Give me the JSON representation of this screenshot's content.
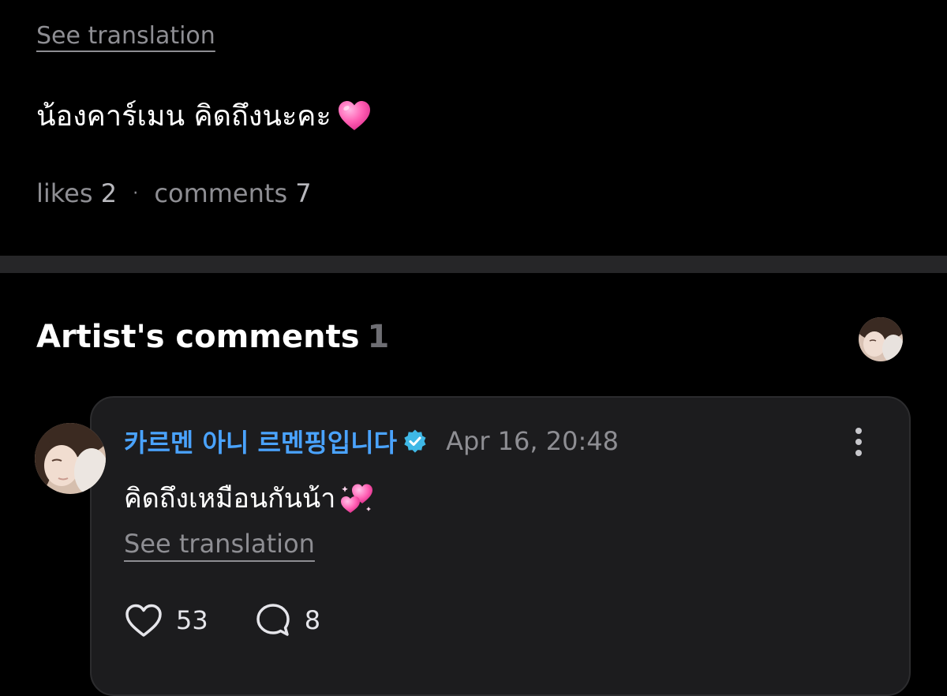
{
  "post": {
    "see_translation": "See translation",
    "text": "น้องคาร์เมน คิดถึงนะคะ",
    "text_emoji": "pink-heart",
    "likes_label": "likes",
    "likes_count": "2",
    "separator": "·",
    "comments_label": "comments",
    "comments_count": "7"
  },
  "artist_comments": {
    "title": "Artist's comments",
    "count": "1",
    "comment": {
      "author": "카르멘 아니 르멘핑입니다",
      "verified_icon": "verified-badge-icon",
      "timestamp": "Apr 16, 20:48",
      "text": "คิดถึงเหมือนกันน้า",
      "text_emoji": "two-hearts",
      "see_translation": "See translation",
      "like_count": "53",
      "reply_count": "8"
    }
  },
  "colors": {
    "background": "#000000",
    "card": "#1c1c1e",
    "divider": "#262628",
    "author": "#4aa3ff",
    "muted": "#8e8e93",
    "verified": "#3fb8e6",
    "heart": "#ff5fb3"
  }
}
